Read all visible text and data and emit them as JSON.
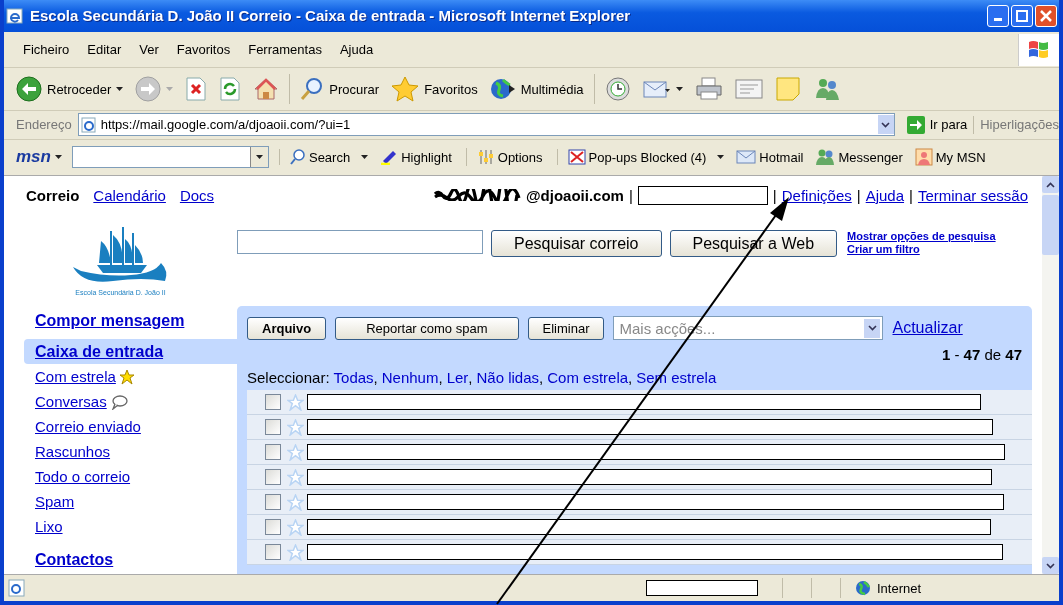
{
  "window": {
    "title": "Escola Secundária D. João II Correio - Caixa de entrada - Microsoft Internet Explorer"
  },
  "menu": [
    "Ficheiro",
    "Editar",
    "Ver",
    "Favoritos",
    "Ferramentas",
    "Ajuda"
  ],
  "toolbar": [
    {
      "kind": "back",
      "label": "Retroceder"
    },
    {
      "kind": "forward"
    },
    {
      "kind": "stop"
    },
    {
      "kind": "refresh"
    },
    {
      "kind": "home"
    },
    {
      "kind": "search",
      "label": "Procurar"
    },
    {
      "kind": "favorites",
      "label": "Favoritos"
    },
    {
      "kind": "media",
      "label": "Multimédia"
    },
    {
      "kind": "history"
    },
    {
      "kind": "mail"
    },
    {
      "kind": "print"
    },
    {
      "kind": "edit"
    },
    {
      "kind": "note"
    },
    {
      "kind": "messenger"
    }
  ],
  "address": {
    "label": "Endereço",
    "url": "https://mail.google.com/a/djoaoii.com/?ui=1",
    "go": "Ir para",
    "links": "Hiperligações"
  },
  "msn_bar": {
    "logo": "msn",
    "items": [
      {
        "kind": "search",
        "label": "Search",
        "dropdown": true,
        "separator_before": true
      },
      {
        "kind": "highlight",
        "label": "Highlight",
        "dropdown": false,
        "separator_before": false
      },
      {
        "kind": "options",
        "label": "Options",
        "dropdown": false,
        "separator_before": true
      },
      {
        "kind": "popups",
        "label": "Pop-ups Blocked (4)",
        "dropdown": true,
        "separator_before": true
      },
      {
        "kind": "hotmail",
        "label": "Hotmail",
        "dropdown": false,
        "separator_before": false
      },
      {
        "kind": "messenger",
        "label": "Messenger",
        "dropdown": false,
        "separator_before": false
      },
      {
        "kind": "mymsn",
        "label": "My MSN",
        "dropdown": false,
        "separator_before": false
      }
    ]
  },
  "gmail": {
    "nav": [
      {
        "label": "Correio",
        "selected": true
      },
      {
        "label": "Calendário",
        "selected": false
      },
      {
        "label": "Docs",
        "selected": false
      }
    ],
    "account": {
      "email": "@djoaoii.com",
      "separator": "|",
      "links": [
        "Definições",
        "Ajuda",
        "Terminar sessão"
      ]
    },
    "logo_caption": "Escola Secundária D. João II",
    "search": {
      "buttons": [
        "Pesquisar correio",
        "Pesquisar a Web"
      ],
      "links": [
        "Mostrar opções de pesquisa",
        "Criar um filtro"
      ]
    },
    "compose": "Compor mensagem",
    "folders": [
      {
        "label": "Caixa de entrada",
        "selected": true,
        "kind": "plain"
      },
      {
        "label": "Com estrela",
        "selected": false,
        "kind": "starred"
      },
      {
        "label": "Conversas",
        "selected": false,
        "kind": "chats"
      },
      {
        "label": "Correio enviado",
        "selected": false,
        "kind": "plain"
      },
      {
        "label": "Rascunhos",
        "selected": false,
        "kind": "plain"
      },
      {
        "label": "Todo o correio",
        "selected": false,
        "kind": "plain"
      },
      {
        "label": "Spam",
        "selected": false,
        "kind": "plain"
      },
      {
        "label": "Lixo",
        "selected": false,
        "kind": "plain"
      }
    ],
    "contacts": "Contactos",
    "actions": {
      "buttons": [
        {
          "label": "Arquivo",
          "bold": true
        },
        {
          "label": "Reportar como spam",
          "bold": false
        },
        {
          "label": "Eliminar",
          "bold": false
        }
      ],
      "more_placeholder": "Mais acções...",
      "refresh": "Actualizar"
    },
    "count": "**1** - **47** de **47**",
    "select": {
      "label": "Seleccionar:",
      "delimiter": ",",
      "options": [
        "Todas",
        "Nenhum",
        "Ler",
        "Não lidas",
        "Com estrela",
        "Sem estrela"
      ]
    },
    "messages": [
      {
        "checked": false,
        "starred": false
      },
      {
        "checked": false,
        "starred": false
      },
      {
        "checked": false,
        "starred": false
      },
      {
        "checked": false,
        "starred": false
      },
      {
        "checked": false,
        "starred": false
      },
      {
        "checked": false,
        "starred": false
      },
      {
        "checked": false,
        "starred": false
      }
    ]
  },
  "status_bar": {
    "zone": "Internet"
  }
}
